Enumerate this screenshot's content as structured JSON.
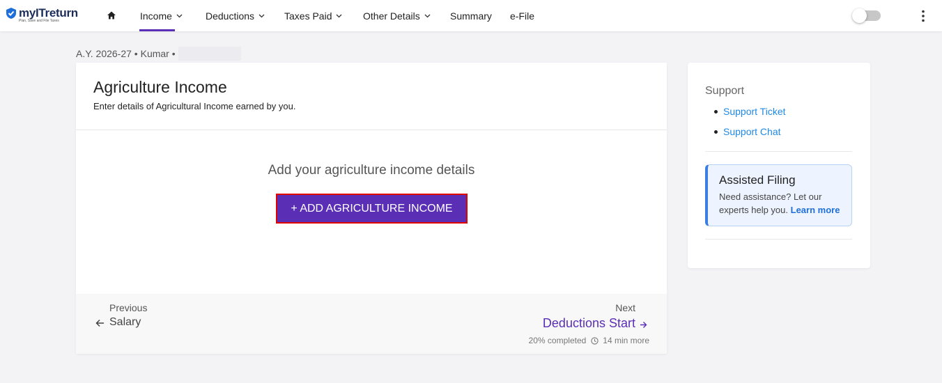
{
  "brand": {
    "name": "myITreturn",
    "tagline": "Plan, Save and File Taxes"
  },
  "nav": {
    "items": [
      {
        "label": "Income",
        "dropdown": true,
        "active": true
      },
      {
        "label": "Deductions",
        "dropdown": true
      },
      {
        "label": "Taxes Paid",
        "dropdown": true
      },
      {
        "label": "Other Details",
        "dropdown": true
      },
      {
        "label": "Summary",
        "dropdown": false
      },
      {
        "label": "e-File",
        "dropdown": false
      }
    ]
  },
  "breadcrumb": {
    "text": "A.Y. 2026-27 • Kumar •"
  },
  "page": {
    "title": "Agriculture Income",
    "subtitle": "Enter details of Agricultural Income earned by you.",
    "empty_text": "Add your agriculture income details",
    "add_button": "+ ADD AGRICULTURE INCOME"
  },
  "footer": {
    "previous_label": "Previous",
    "previous_link": "Salary",
    "next_label": "Next",
    "next_link": "Deductions Start",
    "progress_text": "20% completed",
    "time_text": "14 min more"
  },
  "sidebar": {
    "support_title": "Support",
    "support_links": [
      "Support Ticket",
      "Support Chat"
    ],
    "assist_title": "Assisted Filing",
    "assist_body": "Need assistance? Let our experts help you.",
    "assist_link": "Learn more"
  },
  "colors": {
    "accent": "#5a2fb5",
    "link": "#1e88e5",
    "highlight_border": "#e00000"
  }
}
